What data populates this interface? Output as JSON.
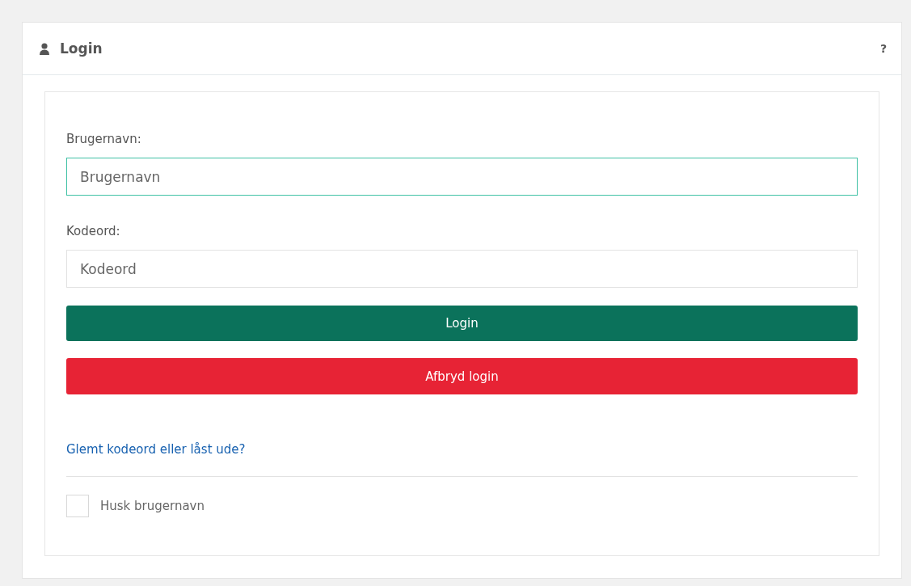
{
  "panel": {
    "title": "Login",
    "help": "?"
  },
  "fields": [
    {
      "label": "Brugernavn:",
      "placeholder": "Brugernavn",
      "focused": true
    },
    {
      "label": "Kodeord:",
      "placeholder": "Kodeord",
      "focused": false
    }
  ],
  "buttons": [
    {
      "label": "Login",
      "kind": "primary"
    },
    {
      "label": "Afbryd login",
      "kind": "danger"
    }
  ],
  "link": "Glemt kodeord eller låst ude?",
  "remember": {
    "label": "Husk brugernavn",
    "checked": false
  }
}
